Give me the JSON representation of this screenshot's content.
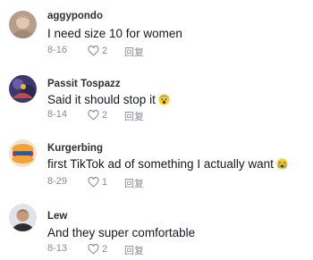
{
  "comments": [
    {
      "username": "aggypondo",
      "text": "I need size 10 for women",
      "emoji": "",
      "date": "8-16",
      "likes": "2",
      "reply_label": "回复"
    },
    {
      "username": "Passit Tospazz",
      "text": "Said it should stop it",
      "emoji": "scared-face-emoji",
      "date": "8-14",
      "likes": "2",
      "reply_label": "回复"
    },
    {
      "username": "Kurgerbing",
      "text": "first TikTok ad of something I actually want",
      "emoji": "crying-face-emoji",
      "date": "8-29",
      "likes": "1",
      "reply_label": "回复"
    },
    {
      "username": "Lew",
      "text": "And they super comfortable",
      "emoji": "",
      "date": "8-13",
      "likes": "2",
      "reply_label": "回复"
    }
  ],
  "colors": {
    "username": "#2f2f2f",
    "text": "#161823",
    "meta": "#8a8b91",
    "background": "#ffffff"
  }
}
